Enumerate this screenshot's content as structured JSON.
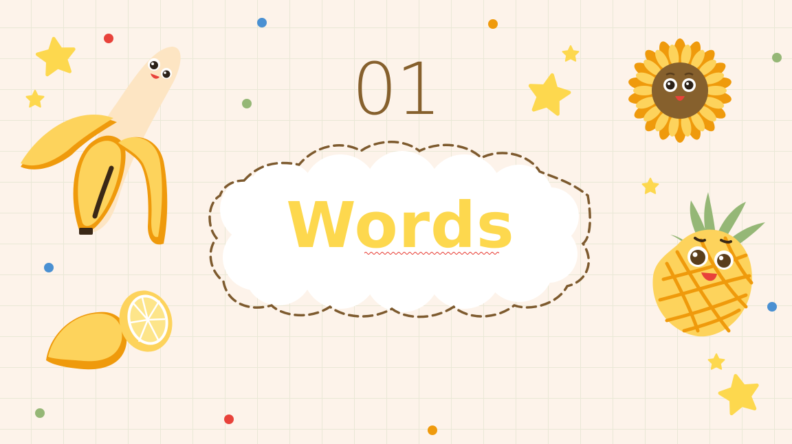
{
  "slide": {
    "number": "01",
    "title": "Words"
  },
  "colors": {
    "background": "#fdf3ea",
    "grid": "#e9e8d6",
    "number": "#86602d",
    "title": "#fdd84e",
    "cloud_border": "#7d5a2e",
    "star": "#fdd84e",
    "dot_red": "#e8423a",
    "dot_blue": "#4a90d2",
    "dot_orange": "#ef9a0c",
    "dot_green": "#95b776"
  },
  "icons": [
    "banana-icon",
    "lemon-icon",
    "sunflower-icon",
    "pineapple-icon",
    "star-icon",
    "confetti-dot"
  ]
}
